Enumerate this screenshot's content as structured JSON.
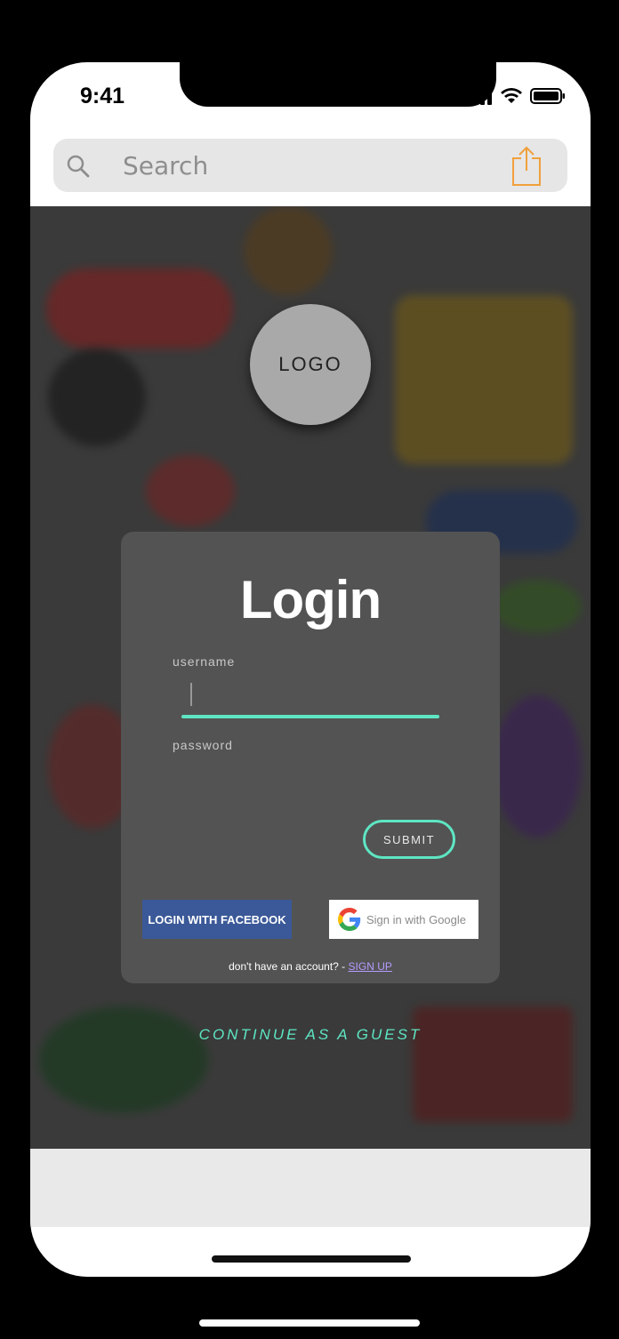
{
  "status_bar": {
    "time": "9:41"
  },
  "search": {
    "placeholder": "Search"
  },
  "hero": {
    "logo_text": "LOGO"
  },
  "login_card": {
    "title": "Login",
    "username_label": "username",
    "username_value": "",
    "password_label": "password",
    "submit_label": "SUBMIT",
    "facebook_label": "LOGIN WITH FACEBOOK",
    "google_label": "Sign in with Google",
    "no_account_text": "don't have an account? - ",
    "signup_label": "SIGN UP"
  },
  "guest": {
    "label": "CONTINUE AS A GUEST"
  },
  "colors": {
    "accent": "#5ee6c3",
    "facebook": "#3b5998",
    "share_icon": "#f0a03c",
    "signup_link": "#b59cff"
  },
  "icons": [
    "search-icon",
    "share-icon",
    "signal-icon",
    "wifi-icon",
    "battery-icon",
    "google-g-icon"
  ]
}
